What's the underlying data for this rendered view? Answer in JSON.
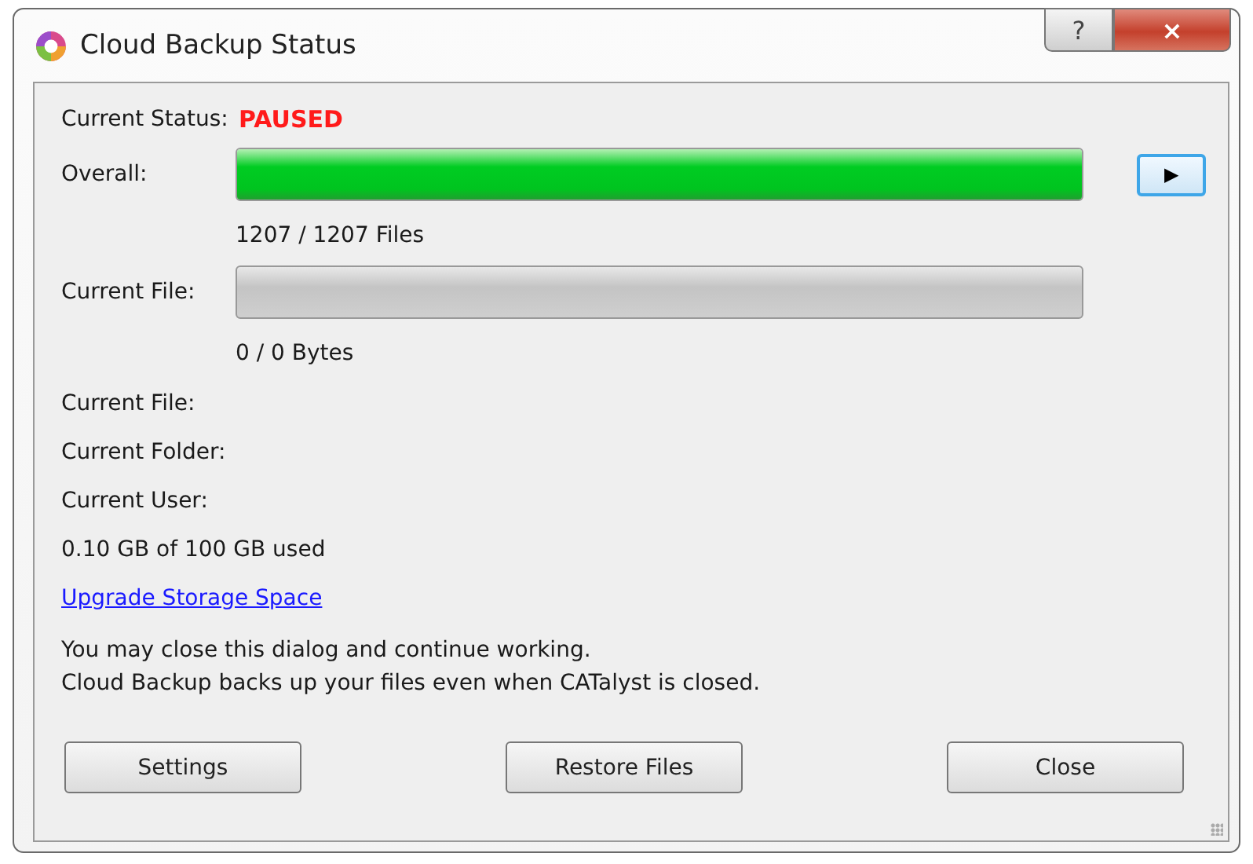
{
  "window": {
    "title": "Cloud Backup Status",
    "help_button": "?",
    "close_button": "×"
  },
  "status": {
    "label": "Current Status:",
    "value": "PAUSED"
  },
  "overall": {
    "label": "Overall:",
    "level": 1,
    "reading": "1207 / 1207 Files",
    "play_button": "▶"
  },
  "current_file_progress": {
    "label": "Current File:",
    "level": 0,
    "reading": "0 / 0 Bytes"
  },
  "details": [
    "Current File:",
    "Current Folder:",
    "Current User:"
  ],
  "usage": "0.10 GB of 100 GB used",
  "upgrade_link": "Upgrade Storage Space",
  "message": [
    "You may close this dialog and continue working.",
    "Cloud Backup backs up your files even when CATalyst is closed."
  ],
  "buttons": [
    "Settings",
    "Restore Files",
    "Close"
  ]
}
